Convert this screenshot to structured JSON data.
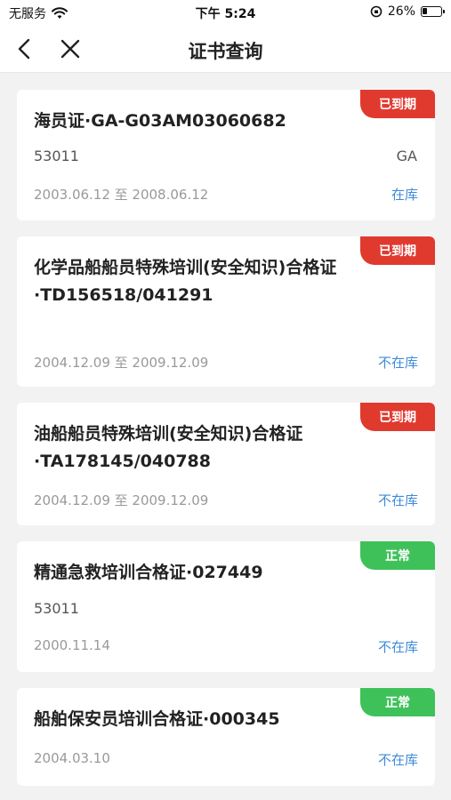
{
  "status_bar": {
    "carrier": "无服务",
    "time": "下午 5:24",
    "battery_percent": "26%",
    "battery_level": 0.26
  },
  "nav": {
    "title": "证书查询"
  },
  "certificates": [
    {
      "title": "海员证·GA-G03AM03060682",
      "badge": "已到期",
      "code": "53011",
      "region": "GA",
      "date_range": "2003.06.12 至 2008.06.12",
      "storage_status": "在库"
    },
    {
      "title": "化学品船船员特殊培训(安全知识)合格证\n·TD156518/041291",
      "badge": "已到期",
      "date_range": "2004.12.09 至 2009.12.09",
      "storage_status": "不在库"
    },
    {
      "title": "油船船员特殊培训(安全知识)合格证\n·TA178145/040788",
      "badge": "已到期",
      "date_range": "2004.12.09 至 2009.12.09",
      "storage_status": "不在库"
    },
    {
      "title": "精通急救培训合格证·027449",
      "badge": "正常",
      "code": "53011",
      "date_range": "2000.11.14",
      "storage_status": "不在库"
    },
    {
      "title": "船舶保安员培训合格证·000345",
      "badge": "正常",
      "date_range": "2004.03.10",
      "storage_status": "不在库"
    }
  ]
}
